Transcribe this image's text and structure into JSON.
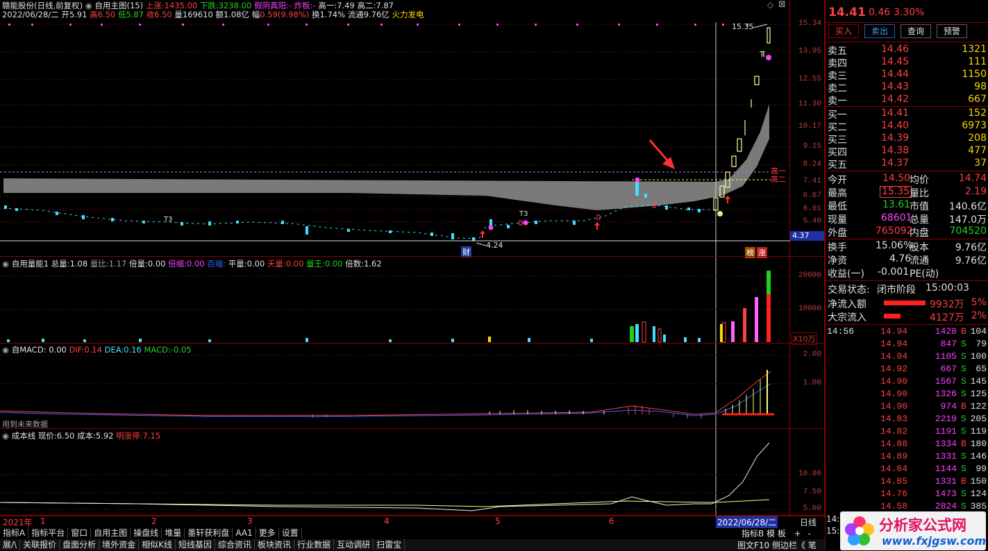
{
  "header": {
    "stock_name": "赣能股份(日线,前复权)",
    "main_chart": "自用主图(15)",
    "up_count_label": "上涨:",
    "up_count": "1435.00",
    "down_count_label": "下跌:",
    "down_count": "3238.00",
    "fake_yin_label": "假阴真阳:",
    "fake_yin_value": "-",
    "zhaban_label": "炸板:",
    "zhaban_value": "-",
    "gao1_label": "高一:",
    "gao1": "7.49",
    "gao2_label": "高二:",
    "gao2": "7.87",
    "date_line": "2022/06/28/二",
    "open_label": "开",
    "open": "5.91",
    "high_label": "高",
    "high": "6.50",
    "low_label": "低",
    "low": "5.87",
    "close_label": "收",
    "close": "6.50",
    "vol_label": "量",
    "vol": "169610",
    "amount_label": "额",
    "amount": "1.08亿",
    "change_label": "幅",
    "change": "0.59(9.98%)",
    "turnover_label": "换",
    "turnover": "1.74%",
    "float_label": "流通",
    "float": "9.76亿",
    "concept": "火力发电"
  },
  "main_axis": [
    "15.34",
    "13.95",
    "12.55",
    "11.30",
    "10.17",
    "9.15",
    "8.24",
    "7.41",
    "6.67",
    "6.01",
    "5.40"
  ],
  "main_annotations": {
    "price_max": "15.35",
    "price_min": "4.24",
    "current_axis_price": "4.37",
    "gao_yi": "高一",
    "gao_er": "高二",
    "cai_badge": "财",
    "bang_badge": "榜",
    "zhang_badge": "涨",
    "t3_a": "T3",
    "t3_b": "T3",
    "t_mark": "T"
  },
  "vol_header": {
    "title": "自用量能1",
    "total_label": "总量:",
    "total": "1.08",
    "ratio_label": "量比:",
    "ratio": "1.17",
    "bei_label": "倍量:",
    "bei": "0.00",
    "beisuo_label": "倍缩:",
    "beisuo": "0.00",
    "baisuo_label": "百缩:",
    "baisuo": "",
    "ping_label": "平量:",
    "ping": "0.00",
    "tian_label": "天量:",
    "tian": "0.00",
    "wang_label": "量王:",
    "wang": "0.00",
    "beishu_label": "倍数:",
    "beishu": "1.62"
  },
  "vol_axis": [
    "20000",
    "10000"
  ],
  "vol_unit": "X10万",
  "macd_header": {
    "title": "自MACD",
    "value": ": 0.00",
    "dif_label": "DIF:",
    "dif": "0.14",
    "dea_label": "DEA:",
    "dea": "0.16",
    "macd_label": "MACD:",
    "macd": "-0.05",
    "note": "用到未来数据"
  },
  "macd_axis": [
    "2.00",
    "1.00"
  ],
  "cost_header": {
    "title": "成本线",
    "now_label": "现价:",
    "now": "6.50",
    "cost_label": "成本:",
    "cost": "5.92",
    "limit_label": "明涨停:",
    "limit": "7.15"
  },
  "cost_axis": [
    "10.00",
    "7.50",
    "5.00"
  ],
  "time_axis": [
    "2021年",
    "1",
    "2",
    "3",
    "4",
    "5",
    "6"
  ],
  "current_date": "2022/06/28/二",
  "period_label": "日线",
  "bottom_tabs1": [
    "指标A",
    "指标平台",
    "窗口",
    "自用主图",
    "操盘线",
    "堆量",
    "墨轩获利盘",
    "AA1",
    "更多",
    "设置"
  ],
  "bottom_tabs1_right": [
    "指标B",
    "模",
    "板"
  ],
  "bottom_tabs2": [
    "展/\\",
    "关联报价",
    "盘面分析",
    "境外资金",
    "相似K线",
    "短线基因",
    "综合资讯",
    "板块资讯",
    "行业数据",
    "互动调研",
    "扫雷宝"
  ],
  "bottom_right2": [
    "图文F10",
    "侧边栏《",
    "笔"
  ],
  "quote": {
    "price": "14.41",
    "change": "0.46",
    "pct": "3.30%",
    "buttons": [
      "买入",
      "卖出",
      "查询",
      "预警"
    ],
    "asks": [
      {
        "label": "卖五",
        "price": "14.46",
        "vol": "1321"
      },
      {
        "label": "卖四",
        "price": "14.45",
        "vol": "111"
      },
      {
        "label": "卖三",
        "price": "14.44",
        "vol": "1150"
      },
      {
        "label": "卖二",
        "price": "14.43",
        "vol": "98"
      },
      {
        "label": "卖一",
        "price": "14.42",
        "vol": "667"
      }
    ],
    "bids": [
      {
        "label": "买一",
        "price": "14.41",
        "vol": "152"
      },
      {
        "label": "买二",
        "price": "14.40",
        "vol": "6973"
      },
      {
        "label": "买三",
        "price": "14.39",
        "vol": "208"
      },
      {
        "label": "买四",
        "price": "14.38",
        "vol": "477"
      },
      {
        "label": "买五",
        "price": "14.37",
        "vol": "37"
      }
    ],
    "stats": [
      {
        "l1": "今开",
        "v1": "14.50",
        "l2": "均价",
        "v2": "14.74"
      },
      {
        "l1": "最高",
        "v1": "15.35",
        "l2": "量比",
        "v2": "2.19"
      },
      {
        "l1": "最低",
        "v1": "13.61",
        "l2": "市值",
        "v2": "140.6亿"
      },
      {
        "l1": "现量",
        "v1": "68601",
        "l2": "总量",
        "v2": "147.0万"
      },
      {
        "l1": "外盘",
        "v1": "765092",
        "l2": "内盘",
        "v2": "704520"
      }
    ],
    "stats2": [
      {
        "l1": "换手",
        "v1": "15.06%",
        "l2": "股本",
        "v2": "9.76亿"
      },
      {
        "l1": "净资",
        "v1": "4.76",
        "l2": "流通",
        "v2": "9.76亿"
      },
      {
        "l1": "收益(一)",
        "v1": "-0.001",
        "l2": "PE(动)",
        "v2": ""
      }
    ],
    "trade_status_label": "交易状态:",
    "trade_status": "闭市阶段",
    "trade_time": "15:00:03",
    "flow": [
      {
        "label": "净流入额",
        "value": "9932万",
        "pct": "5%"
      },
      {
        "label": "大宗流入",
        "value": "4127万",
        "pct": "2%"
      }
    ],
    "ticks": [
      {
        "t": "14:56",
        "p": "14.94",
        "v": "1428",
        "s": "B",
        "n": "104"
      },
      {
        "t": "",
        "p": "14.94",
        "v": "847",
        "s": "S",
        "n": "79"
      },
      {
        "t": "",
        "p": "14.94",
        "v": "1105",
        "s": "S",
        "n": "100"
      },
      {
        "t": "",
        "p": "14.92",
        "v": "667",
        "s": "S",
        "n": "65"
      },
      {
        "t": "",
        "p": "14.90",
        "v": "1567",
        "s": "S",
        "n": "145"
      },
      {
        "t": "",
        "p": "14.90",
        "v": "1326",
        "s": "S",
        "n": "125"
      },
      {
        "t": "",
        "p": "14.90",
        "v": "974",
        "s": "B",
        "n": "122"
      },
      {
        "t": "",
        "p": "14.83",
        "v": "2219",
        "s": "S",
        "n": "205"
      },
      {
        "t": "",
        "p": "14.82",
        "v": "1191",
        "s": "S",
        "n": "119"
      },
      {
        "t": "",
        "p": "14.88",
        "v": "1334",
        "s": "B",
        "n": "180"
      },
      {
        "t": "",
        "p": "14.89",
        "v": "1331",
        "s": "S",
        "n": "146"
      },
      {
        "t": "",
        "p": "14.84",
        "v": "1144",
        "s": "S",
        "n": "99"
      },
      {
        "t": "",
        "p": "14.85",
        "v": "1331",
        "s": "B",
        "n": "150"
      },
      {
        "t": "",
        "p": "14.76",
        "v": "1473",
        "s": "S",
        "n": "124"
      },
      {
        "t": "",
        "p": "14.58",
        "v": "2824",
        "s": "S",
        "n": "385"
      }
    ],
    "tick_time_bottom1": "14:5",
    "tick_time_bottom2": "15:0"
  },
  "watermark": {
    "name": "分析家公式网",
    "url": "www.fxjgsw.com"
  }
}
